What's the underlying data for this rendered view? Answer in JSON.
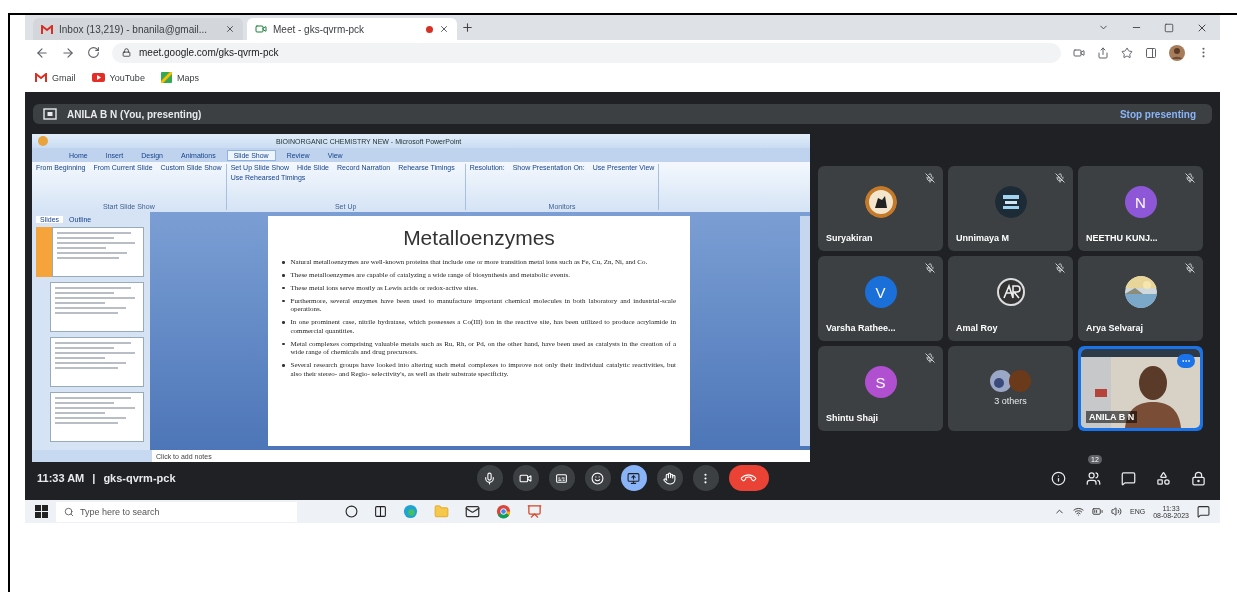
{
  "browser": {
    "tabs": [
      {
        "title": "Inbox (13,219) - bnanila@gmail...",
        "kind": "gmail",
        "selected": false
      },
      {
        "title": "Meet - gks-qvrm-pck",
        "kind": "meet",
        "selected": true,
        "recording": true
      }
    ],
    "address": "meet.google.com/gks-qvrm-pck",
    "bookmarks": [
      {
        "label": "Gmail",
        "kind": "gmail"
      },
      {
        "label": "YouTube",
        "kind": "youtube"
      },
      {
        "label": "Maps",
        "kind": "maps"
      }
    ]
  },
  "presenting_bar": {
    "label": "ANILA B N (You, presenting)",
    "button": "Stop presenting"
  },
  "shared_screen": {
    "title": "BIOINORGANIC CHEMISTRY NEW - Microsoft PowerPoint",
    "ribbon_tabs": [
      {
        "label": "Home",
        "selected": false
      },
      {
        "label": "Insert",
        "selected": false
      },
      {
        "label": "Design",
        "selected": false
      },
      {
        "label": "Animations",
        "selected": false
      },
      {
        "label": "Slide Show",
        "selected": true
      },
      {
        "label": "Review",
        "selected": false
      },
      {
        "label": "View",
        "selected": false
      }
    ],
    "ribbon_groups": [
      {
        "label": "Start Slide Show",
        "buttons": [
          "From Beginning",
          "From Current Slide",
          "Custom Slide Show"
        ]
      },
      {
        "label": "Set Up",
        "buttons": [
          "Set Up Slide Show",
          "Hide Slide",
          "Record Narration",
          "Rehearse Timings",
          "Use Rehearsed Timings"
        ]
      },
      {
        "label": "Monitors",
        "buttons": [
          "Resolution:",
          "Show Presentation On:",
          "Use Presenter View"
        ]
      }
    ],
    "pane_tabs": [
      {
        "label": "Slides",
        "selected": true
      },
      {
        "label": "Outline",
        "selected": false
      }
    ],
    "thumbnails": [
      {
        "selected": true
      },
      {
        "selected": false
      },
      {
        "selected": false
      },
      {
        "selected": false
      }
    ],
    "slide": {
      "title": "Metalloenzymes",
      "bullets": [
        "Natural metalloenzymes are well-known proteins that include one or more transition metal ions such as Fe, Cu, Zn, Ni, and Co.",
        "These metalloenzymes are capable of catalyzing a wide range of biosynthesis and metabolic events.",
        "These metal ions serve mostly as Lewis acids or redox-active sites.",
        "Furthermore, several enzymes have been used to manufacture important chemical molecules in both laboratory and industrial-scale operations.",
        "In one prominent case, nitrile hydratase, which possesses a Co(III) ion in the reactive site, has been utilized to produce acrylamide in commercial quantities.",
        "Metal complexes comprising valuable metals such as Ru, Rh, or Pd, on the other hand, have been used as catalysts in the creation of a wide range of chemicals and drug precursors.",
        "Several research groups have looked into altering such metal complexes to improve not only their individual catalytic reactivities, but also their stereo- and Regio- selectivity's, as well as their substrate specificity."
      ]
    },
    "notes_placeholder": "Click to add notes"
  },
  "tiles": [
    {
      "name": "Suryakiran",
      "kind": "person",
      "muted": true
    },
    {
      "name": "Unnimaya M",
      "kind": "person",
      "muted": true
    },
    {
      "name": "NEETHU KUNJ...",
      "kind": "person",
      "muted": true,
      "avatar": {
        "kind": "letter",
        "letter": "N",
        "color": "#8e57d8"
      }
    },
    {
      "name": "Varsha Rathee...",
      "kind": "person",
      "muted": true,
      "avatar": {
        "kind": "letter",
        "letter": "V",
        "color": "#1a6fd8"
      }
    },
    {
      "name": "Amal Roy",
      "kind": "person",
      "muted": true,
      "avatar": {
        "kind": "monogram"
      }
    },
    {
      "name": "Arya Selvaraj",
      "kind": "person",
      "muted": true
    },
    {
      "name": "Shintu Shaji",
      "kind": "person",
      "muted": true,
      "avatar": {
        "kind": "letter",
        "letter": "S",
        "color": "#b04fd0"
      }
    },
    {
      "name": "3 others",
      "kind": "others",
      "muted": false
    },
    {
      "name": "ANILA B N",
      "kind": "self",
      "muted": false
    }
  ],
  "call_bar": {
    "time": "11:33 AM",
    "separator": "|",
    "meeting_code": "gks-qvrm-pck",
    "controls": [
      {
        "kind": "mic",
        "active": false
      },
      {
        "kind": "camera",
        "active": false
      },
      {
        "kind": "captions",
        "active": false
      },
      {
        "kind": "emoji",
        "active": false
      },
      {
        "kind": "present",
        "active": true
      },
      {
        "kind": "hand",
        "active": false
      },
      {
        "kind": "more",
        "active": false
      },
      {
        "kind": "hangup"
      }
    ],
    "side_controls": [
      {
        "kind": "info"
      },
      {
        "kind": "people",
        "badge": "12"
      },
      {
        "kind": "chat"
      },
      {
        "kind": "activities"
      },
      {
        "kind": "host"
      }
    ]
  },
  "taskbar": {
    "search_placeholder": "Type here to search",
    "apps": [
      {
        "kind": "cortana"
      },
      {
        "kind": "taskview"
      },
      {
        "kind": "edge"
      },
      {
        "kind": "files"
      },
      {
        "kind": "mail"
      },
      {
        "kind": "chrome"
      },
      {
        "kind": "powerpoint"
      }
    ],
    "language": "ENG",
    "time": "11:33",
    "date": "08-08-2023"
  }
}
